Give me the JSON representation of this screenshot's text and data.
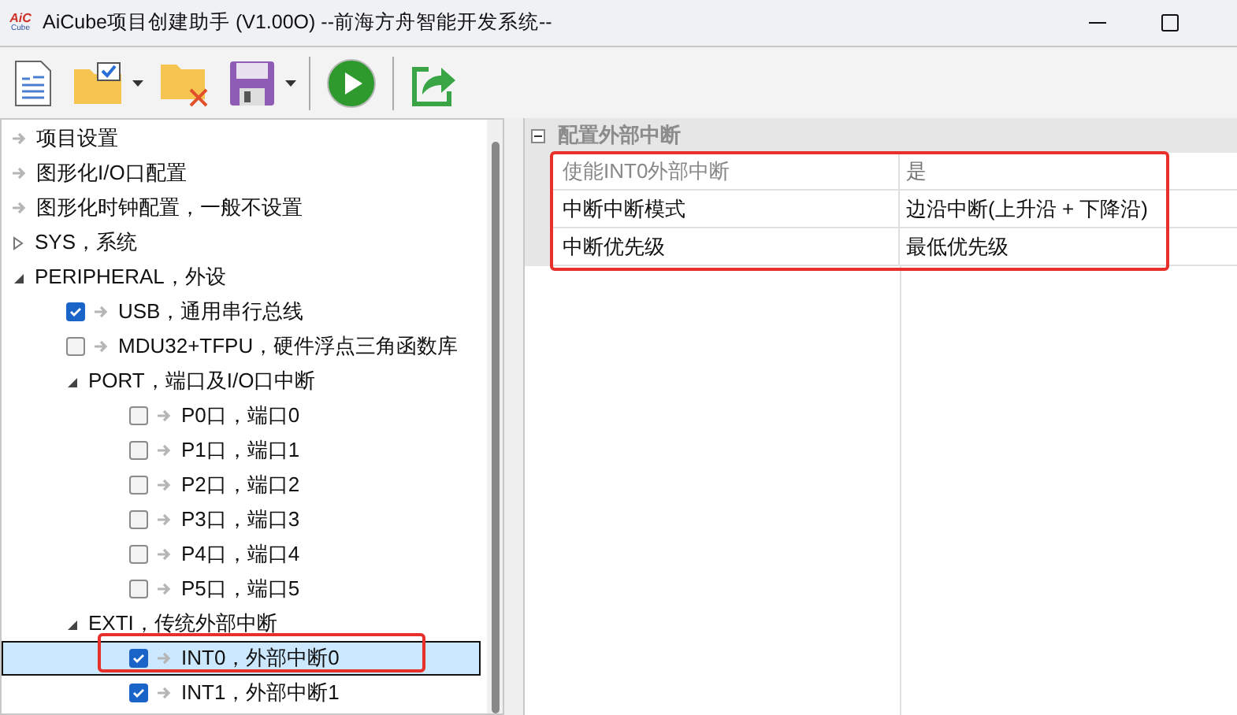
{
  "window": {
    "logo": {
      "top": "AiC",
      "bottom": "Cube"
    },
    "title": "AiCube项目创建助手 (V1.00O) --前海方舟智能开发系统--"
  },
  "toolbar": [
    {
      "kind": "new-document",
      "dropdown": false
    },
    {
      "kind": "open-folder",
      "dropdown": true
    },
    {
      "kind": "close-folder",
      "dropdown": false
    },
    {
      "kind": "save",
      "dropdown": true
    },
    {
      "kind": "separator"
    },
    {
      "kind": "run",
      "dropdown": false
    },
    {
      "kind": "separator"
    },
    {
      "kind": "export",
      "dropdown": false
    }
  ],
  "tree": [
    {
      "kind": "leaf",
      "label": "项目设置",
      "selected": false
    },
    {
      "kind": "leaf",
      "label": "图形化I/O口配置",
      "selected": false
    },
    {
      "kind": "leaf",
      "label": "图形化时钟配置，一般不设置",
      "selected": false
    },
    {
      "kind": "group",
      "label": "SYS，系统",
      "expanded": false,
      "selected": false
    },
    {
      "kind": "group",
      "label": "PERIPHERAL，外设",
      "expanded": true,
      "selected": false,
      "children": [
        {
          "kind": "option",
          "label": "USB，通用串行总线",
          "checked": true,
          "selected": false
        },
        {
          "kind": "option",
          "label": "MDU32+TFPU，硬件浮点三角函数库",
          "checked": false,
          "selected": false
        },
        {
          "kind": "group",
          "label": "PORT，端口及I/O口中断",
          "expanded": true,
          "selected": false,
          "children": [
            {
              "kind": "option",
              "label": "P0口，端口0",
              "checked": false,
              "selected": false
            },
            {
              "kind": "option",
              "label": "P1口，端口1",
              "checked": false,
              "selected": false
            },
            {
              "kind": "option",
              "label": "P2口，端口2",
              "checked": false,
              "selected": false
            },
            {
              "kind": "option",
              "label": "P3口，端口3",
              "checked": false,
              "selected": false
            },
            {
              "kind": "option",
              "label": "P4口，端口4",
              "checked": false,
              "selected": false
            },
            {
              "kind": "option",
              "label": "P5口，端口5",
              "checked": false,
              "selected": false
            }
          ]
        },
        {
          "kind": "group",
          "label": "EXTI，传统外部中断",
          "expanded": true,
          "selected": false,
          "children": [
            {
              "kind": "option",
              "label": "INT0，外部中断0",
              "checked": true,
              "selected": true
            },
            {
              "kind": "option",
              "label": "INT1，外部中断1",
              "checked": true,
              "selected": false
            }
          ]
        }
      ]
    }
  ],
  "properties": {
    "category": {
      "label": "配置外部中断",
      "expanded": true
    },
    "rows": [
      {
        "label": "使能INT0外部中断",
        "value": "是",
        "disabled": true
      },
      {
        "label": "中断中断模式",
        "value": "边沿中断(上升沿 + 下降沿)",
        "disabled": false
      },
      {
        "label": "中断优先级",
        "value": "最低优先级",
        "disabled": false
      }
    ]
  }
}
